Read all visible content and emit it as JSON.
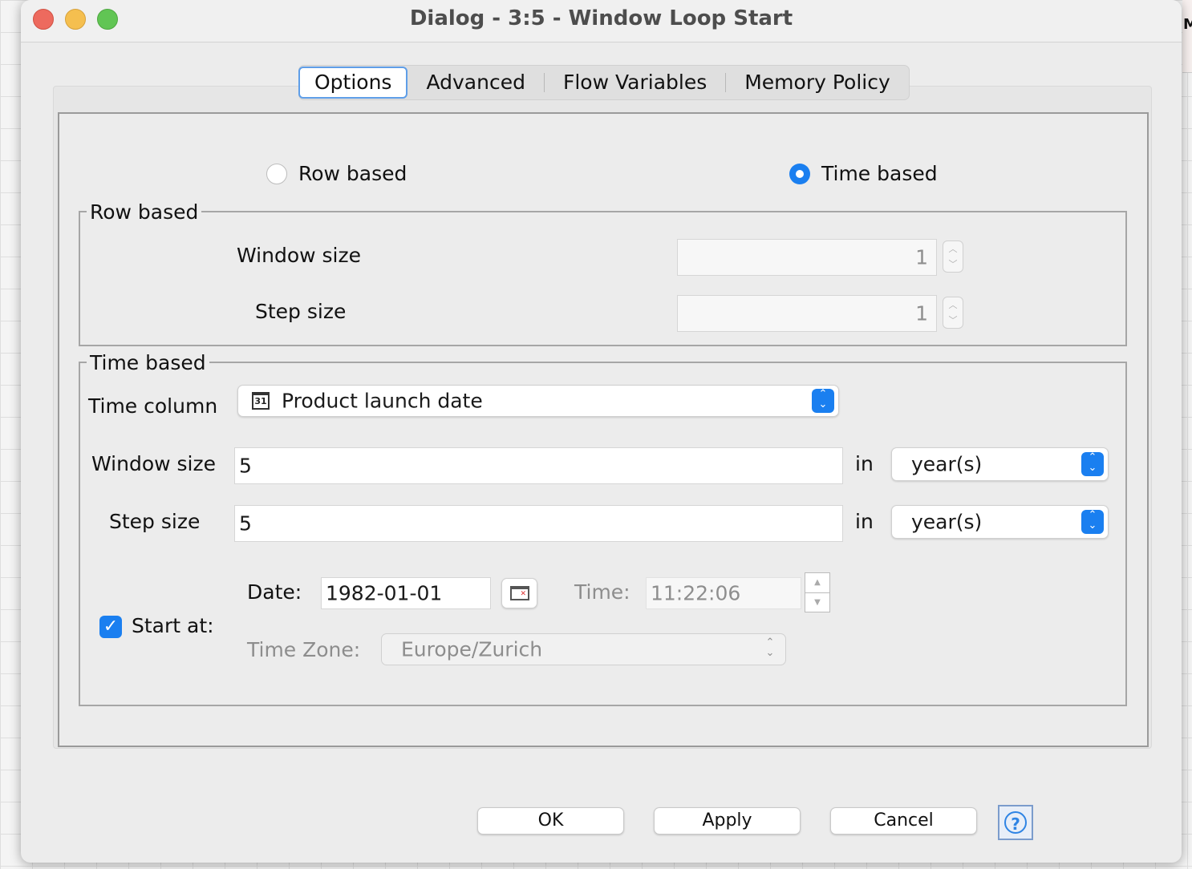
{
  "window": {
    "title": "Dialog - 3:5 - Window Loop Start"
  },
  "background_peek": {
    "letter": "M"
  },
  "tabs": [
    {
      "label": "Options",
      "active": true
    },
    {
      "label": "Advanced",
      "active": false
    },
    {
      "label": "Flow Variables",
      "active": false
    },
    {
      "label": "Memory Policy",
      "active": false
    }
  ],
  "mode": {
    "row_based_label": "Row based",
    "time_based_label": "Time based",
    "selected": "Time based"
  },
  "row_based_group": {
    "title": "Row based",
    "window_size_label": "Window size",
    "window_size_value": "1",
    "step_size_label": "Step size",
    "step_size_value": "1"
  },
  "time_based_group": {
    "title": "Time based",
    "time_column_label": "Time column",
    "time_column_icon_text": "31",
    "time_column_value": "Product launch date",
    "window_size_label": "Window size",
    "window_size_value": "5",
    "window_unit_label": "in",
    "window_unit_value": "year(s)",
    "step_size_label": "Step size",
    "step_size_value": "5",
    "step_unit_label": "in",
    "step_unit_value": "year(s)",
    "start_at_label": "Start at:",
    "start_at_checked": true,
    "date_label": "Date:",
    "date_value": "1982-01-01",
    "time_label": "Time:",
    "time_value": "11:22:06",
    "time_zone_label": "Time Zone:",
    "time_zone_value": "Europe/Zurich"
  },
  "buttons": {
    "ok": "OK",
    "apply": "Apply",
    "cancel": "Cancel",
    "help": "?"
  },
  "colors": {
    "accent": "#1a7ff0",
    "tab_border": "#5f9ee8"
  }
}
